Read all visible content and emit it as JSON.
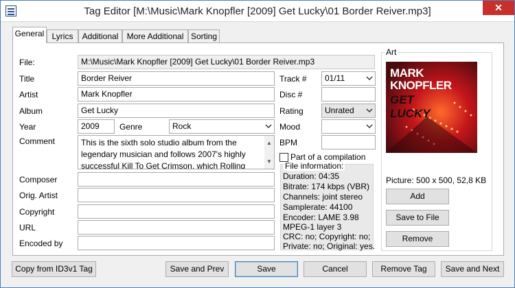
{
  "window": {
    "title": "Tag Editor [M:\\Music\\Mark Knopfler [2009] Get Lucky\\01 Border Reiver.mp3]",
    "close_glyph": "✕"
  },
  "tabs": [
    {
      "label": "General"
    },
    {
      "label": "Lyrics"
    },
    {
      "label": "Additional"
    },
    {
      "label": "More Additional"
    },
    {
      "label": "Sorting"
    }
  ],
  "labels": {
    "file": "File:",
    "title": "Title",
    "artist": "Artist",
    "album": "Album",
    "year": "Year",
    "genre": "Genre",
    "comment": "Comment",
    "composer": "Composer",
    "orig_artist": "Orig. Artist",
    "copyright": "Copyright",
    "url": "URL",
    "encoded_by": "Encoded by",
    "track": "Track #",
    "disc": "Disc #",
    "rating": "Rating",
    "mood": "Mood",
    "bpm": "BPM",
    "compilation": "Part of a compilation",
    "file_info": "File information:",
    "art": "Art"
  },
  "values": {
    "file": "M:\\Music\\Mark Knopfler [2009] Get Lucky\\01 Border Reiver.mp3",
    "title": "Border Reiver",
    "artist": "Mark Knopfler",
    "album": "Get Lucky",
    "year": "2009",
    "genre": "Rock",
    "comment_lines": [
      "This is the sixth solo studio album from the",
      "legendary musician and follows 2007's highly",
      "successful Kill To Get Crimson, which Rolling"
    ],
    "composer": "",
    "orig_artist": "",
    "copyright": "",
    "url": "",
    "encoded_by": "",
    "track": "01/11",
    "disc": "",
    "rating": "Unrated",
    "mood": "",
    "bpm": "",
    "compilation_checked": false
  },
  "file_info": [
    "Duration: 04:35",
    "Bitrate: 174 kbps (VBR)",
    "Channels: joint stereo",
    "Samplerate: 44100",
    "Encoder: LAME 3.98",
    "MPEG-1 layer 3",
    "CRC: no; Copyright: no;",
    "Private: no; Original: yes."
  ],
  "art": {
    "cover_line1": "MARK",
    "cover_line2": "KNOPFLER",
    "cover_line3": "GET",
    "cover_line4": "LUCKY",
    "picture_info": "Picture: 500 x 500, 52,8 KB",
    "add": "Add",
    "save_to_file": "Save to File",
    "remove": "Remove"
  },
  "buttons": {
    "copy_from_id3v1": "Copy from ID3v1 Tag",
    "save_and_prev": "Save and Prev",
    "save": "Save",
    "cancel": "Cancel",
    "remove_tag": "Remove Tag",
    "save_and_next": "Save and Next"
  },
  "colors": {
    "close": "#c7302b",
    "cover_red": "#b3141c",
    "focus_border": "#3c7fb1"
  }
}
